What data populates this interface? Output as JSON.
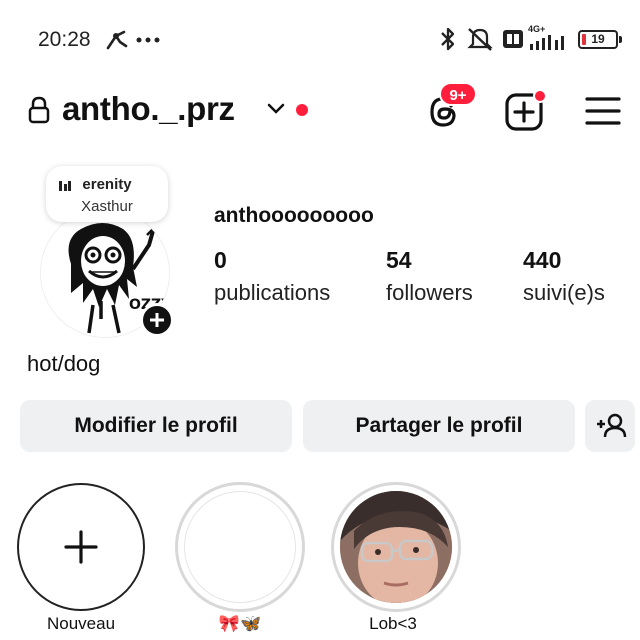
{
  "status_bar": {
    "time": "20:28",
    "network_label": "4G+",
    "battery_level": "19",
    "icons": [
      "app-notification-icon",
      "more-dots-icon",
      "bluetooth-icon",
      "silent-icon",
      "data-icon",
      "signal-icon",
      "battery-icon"
    ]
  },
  "header": {
    "username": "antho._.prz",
    "notification_badge": "9+",
    "accent_color": "#ff1f3d",
    "icons": [
      "lock-icon",
      "chevron-down-icon",
      "threads-icon",
      "create-post-icon",
      "menu-icon"
    ]
  },
  "profile": {
    "note": {
      "title": "erenity",
      "artist": "Xasthur"
    },
    "display_name": "anthooooooooo",
    "stats": [
      {
        "count": "0",
        "label": "publications"
      },
      {
        "count": "54",
        "label": "followers"
      },
      {
        "count": "440",
        "label": "suivi(e)s"
      }
    ],
    "bio": "hot/dog"
  },
  "actions": {
    "edit_label": "Modifier le profil",
    "share_label": "Partager le profil",
    "discover_icon": "add-person-icon"
  },
  "highlights": [
    {
      "label": "Nouveau",
      "icon": "plus-icon"
    },
    {
      "label": "🎀🦋"
    },
    {
      "label": "Lob<3"
    }
  ]
}
